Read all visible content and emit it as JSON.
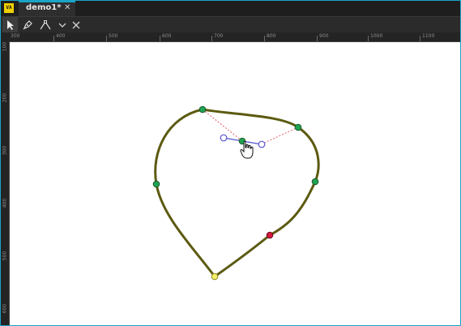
{
  "app": {
    "icon_text": "VA"
  },
  "tab": {
    "title": "demo1*",
    "close_glyph": "✕"
  },
  "toolbar": {
    "tools": [
      {
        "name": "select-tool-icon",
        "active": true
      },
      {
        "name": "pen-tool-icon",
        "active": false
      },
      {
        "name": "node-tool-icon",
        "active": false
      },
      {
        "name": "chevron-down-icon",
        "active": false
      },
      {
        "name": "close-icon",
        "active": false
      }
    ]
  },
  "ruler_top_labels": [
    "300",
    "400",
    "500",
    "600",
    "700",
    "800",
    "900",
    "1000",
    "1100"
  ],
  "ruler_left_labels": [
    "100",
    "200",
    "300",
    "400",
    "500",
    "600"
  ],
  "colors": {
    "accent": "#19a3c7",
    "path_stroke": "#5c5a10",
    "node_fill": "#1fa352",
    "selected_node_fill": "#d4183d",
    "start_node_fill": "#f5f06a",
    "handle_line": "#5555cc",
    "guide_line": "#e0606a"
  }
}
